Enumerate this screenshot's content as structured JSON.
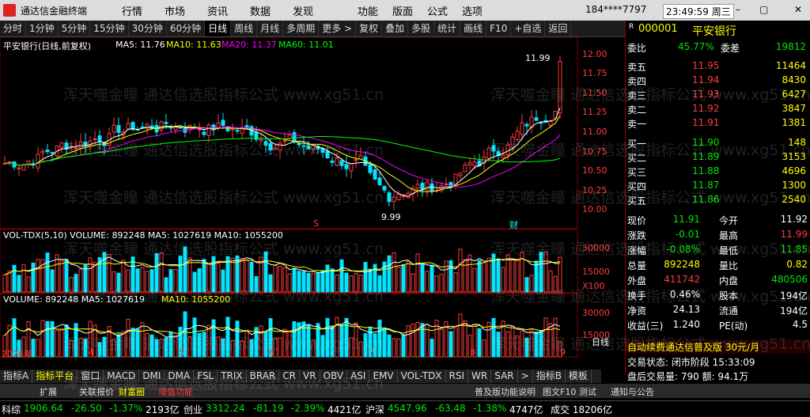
{
  "app": {
    "name": "通达信金融终端"
  },
  "menu": [
    "行情",
    "市场",
    "资讯",
    "数据",
    "发现"
  ],
  "menu_right": [
    "功能",
    "版面",
    "公式",
    "选项"
  ],
  "account": {
    "user": "184****7797",
    "time": "23:49:59 周三"
  },
  "toolbar": [
    "分时",
    "1分钟",
    "5分钟",
    "15分钟",
    "30分钟",
    "60分钟",
    "日线",
    "周线",
    "月线",
    "多周期",
    "更多 >",
    "复权",
    "叠加",
    "多股",
    "统计",
    "画线",
    "F10",
    "+自选",
    "返回"
  ],
  "toolbar_active": "日线",
  "chart": {
    "title": "平安银行(日线,前复权)",
    "ma_label": "MA5: 11.76",
    "ma10_label": "MA10: 11.63",
    "ma20_label": "MA20: 11.37",
    "ma60_label": "MA60: 11.01",
    "high_mark": "11.99",
    "low_mark": "9.99",
    "price_ticks": [
      "12.00",
      "11.75",
      "11.50",
      "11.25",
      "11.00",
      "10.75",
      "10.50",
      "10.25",
      "10.00"
    ],
    "markers": {
      "s": "S",
      "cai": "财"
    },
    "vol_tdx_label": "VOL-TDX(5,10) VOLUME: 892248 MA5: 1027619 MA10: 1055200",
    "vol_ticks": [
      "30000",
      "15000",
      "X100"
    ],
    "volume_label": "VOLUME: 892248 MA5: 1027619",
    "volume_ma10": "MA10: 1055200",
    "vol2_ticks": [
      "30000",
      "15000"
    ],
    "x_labels": [
      "2026年",
      "3",
      "4",
      "5",
      "6",
      "7",
      "8",
      "9"
    ],
    "period_label": "日线"
  },
  "quote": {
    "code": "000001",
    "name": "平安银行",
    "weibi_label": "委比",
    "weibi": "45.77%",
    "weicha_label": "委差",
    "weicha": "19812",
    "asks": [
      {
        "label": "卖五",
        "price": "11.95",
        "vol": "11464"
      },
      {
        "label": "卖四",
        "price": "11.94",
        "vol": "8430"
      },
      {
        "label": "卖三",
        "price": "11.93",
        "vol": "6427"
      },
      {
        "label": "卖二",
        "price": "11.92",
        "vol": "3847"
      },
      {
        "label": "卖一",
        "price": "11.91",
        "vol": "1381"
      }
    ],
    "bids": [
      {
        "label": "买一",
        "price": "11.90",
        "vol": "148"
      },
      {
        "label": "买二",
        "price": "11.89",
        "vol": "3153"
      },
      {
        "label": "买三",
        "price": "11.88",
        "vol": "4696"
      },
      {
        "label": "买四",
        "price": "11.87",
        "vol": "1300"
      },
      {
        "label": "买五",
        "price": "11.86",
        "vol": "2540"
      }
    ],
    "stats": [
      {
        "l1": "现价",
        "v1": "11.91",
        "l2": "今开",
        "v2": "11.92"
      },
      {
        "l1": "涨跌",
        "v1": "-0.01",
        "l2": "最高",
        "v2": "11.99"
      },
      {
        "l1": "涨幅",
        "v1": "-0.08%",
        "l2": "最低",
        "v2": "11.85"
      },
      {
        "l1": "总量",
        "v1": "892248",
        "l2": "量比",
        "v2": "0.82"
      },
      {
        "l1": "外盘",
        "v1": "411742",
        "l2": "内盘",
        "v2": "480506"
      },
      {
        "l1": "换手",
        "v1": "0.46%",
        "l2": "股本",
        "v2": "194亿"
      },
      {
        "l1": "净资",
        "v1": "24.13",
        "l2": "流通",
        "v2": "194亿"
      },
      {
        "l1": "收益(三)",
        "v1": "1.240",
        "l2": "PE(动)",
        "v2": "4.5"
      }
    ],
    "promo": "自动续费通达信普及版 30元/月",
    "trade_state": "交易状态: 闭市阶段 15:33:09",
    "after_hours": "盘后交易量: 790  额: 94.1万"
  },
  "indicator_tabs": [
    "指标A",
    "指标平台",
    "窗口",
    "MACD",
    "DMI",
    "DMA",
    "FSL",
    "TRIX",
    "BRAR",
    "CR",
    "VR",
    "OBV",
    "ASI",
    "EMV",
    "VOL-TDX",
    "RSI",
    "WR",
    "SAR",
    ">",
    "指标B",
    "模板"
  ],
  "indicator_active": "指标平台",
  "sub_tabs": [
    "扩展",
    "关联报价",
    "财富圈",
    "增值功能"
  ],
  "sub_right": [
    "普及版功能说明",
    "图文F10 测试",
    "通知与公告"
  ],
  "status": [
    {
      "name": "科综",
      "v": "1906.64",
      "c": "-26.50",
      "p": "-1.37%",
      "a": "2193亿"
    },
    {
      "name": "创业",
      "v": "3312.24",
      "c": "-81.19",
      "p": "-2.39%",
      "a": "4421亿"
    },
    {
      "name": "沪深",
      "v": "4547.96",
      "c": "-63.48",
      "p": "-1.38%",
      "a": "4747亿"
    }
  ],
  "status_right": "成交 18206亿",
  "watermark": "浑天噬金瞳 通达信选股指标公式 www.xg51.cn",
  "colors": {
    "up": "#ff3c3c",
    "down": "#00e6ff",
    "ma5": "#ffffff",
    "ma10": "#ffff00",
    "ma20": "#ff00ff",
    "ma60": "#00ff00"
  }
}
